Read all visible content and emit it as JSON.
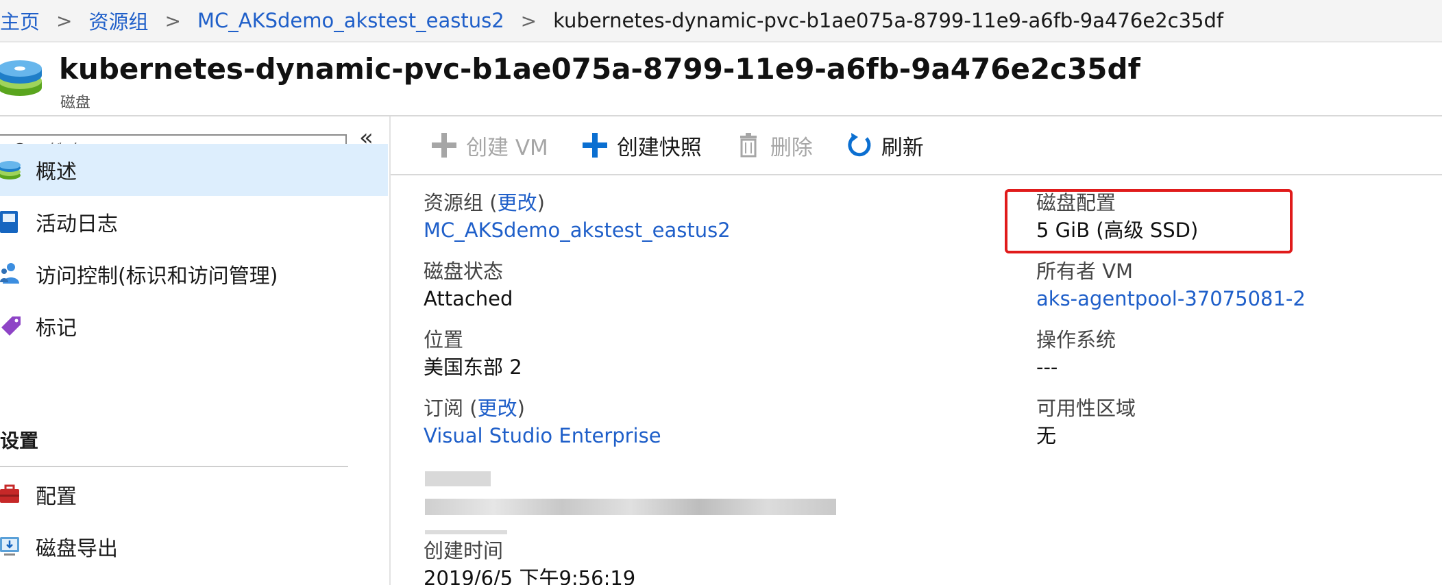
{
  "breadcrumb": {
    "items": [
      "主页",
      "资源组",
      "MC_AKSdemo_akstest_eastus2"
    ],
    "current": "kubernetes-dynamic-pvc-b1ae075a-8799-11e9-a6fb-9a476e2c35df",
    "separator": ">"
  },
  "resource": {
    "title": "kubernetes-dynamic-pvc-b1ae075a-8799-11e9-a6fb-9a476e2c35df",
    "type": "磁盘",
    "icon": "disk-icon"
  },
  "sidebar": {
    "collapse_label": "«",
    "search_placeholder": "搜索(Ctrl+/)",
    "items": [
      {
        "label": "概述",
        "icon": "overview-disk-icon",
        "active": true
      },
      {
        "label": "活动日志",
        "icon": "activity-log-icon"
      },
      {
        "label": "访问控制(标识和访问管理)",
        "icon": "access-control-icon"
      },
      {
        "label": "标记",
        "icon": "tag-icon"
      }
    ],
    "section_settings": "设置",
    "settings_items": [
      {
        "label": "配置",
        "icon": "configuration-icon"
      },
      {
        "label": "磁盘导出",
        "icon": "disk-export-icon"
      }
    ]
  },
  "toolbar": {
    "create_vm": "创建 VM",
    "create_snapshot": "创建快照",
    "delete": "删除",
    "refresh": "刷新"
  },
  "essentials": {
    "resource_group_label": "资源组",
    "change_label": "更改",
    "resource_group_value": "MC_AKSdemo_akstest_eastus2",
    "disk_state_label": "磁盘状态",
    "disk_state_value": "Attached",
    "location_label": "位置",
    "location_value": "美国东部 2",
    "subscription_label": "订阅",
    "subscription_value": "Visual Studio Enterprise",
    "created_label": "创建时间",
    "created_value": "2019/6/5 下午9:56:19",
    "disk_config_label": "磁盘配置",
    "disk_config_value": "5 GiB (高级 SSD)",
    "owner_vm_label": "所有者 VM",
    "owner_vm_value": "aks-agentpool-37075081-2",
    "os_label": "操作系统",
    "os_value": "---",
    "zone_label": "可用性区域",
    "zone_value": "无"
  },
  "colors": {
    "link": "#1f5fc9",
    "active_nav": "#ddeefd",
    "highlight": "#e01b1b",
    "toolbar_blue": "#0b6fd1"
  }
}
